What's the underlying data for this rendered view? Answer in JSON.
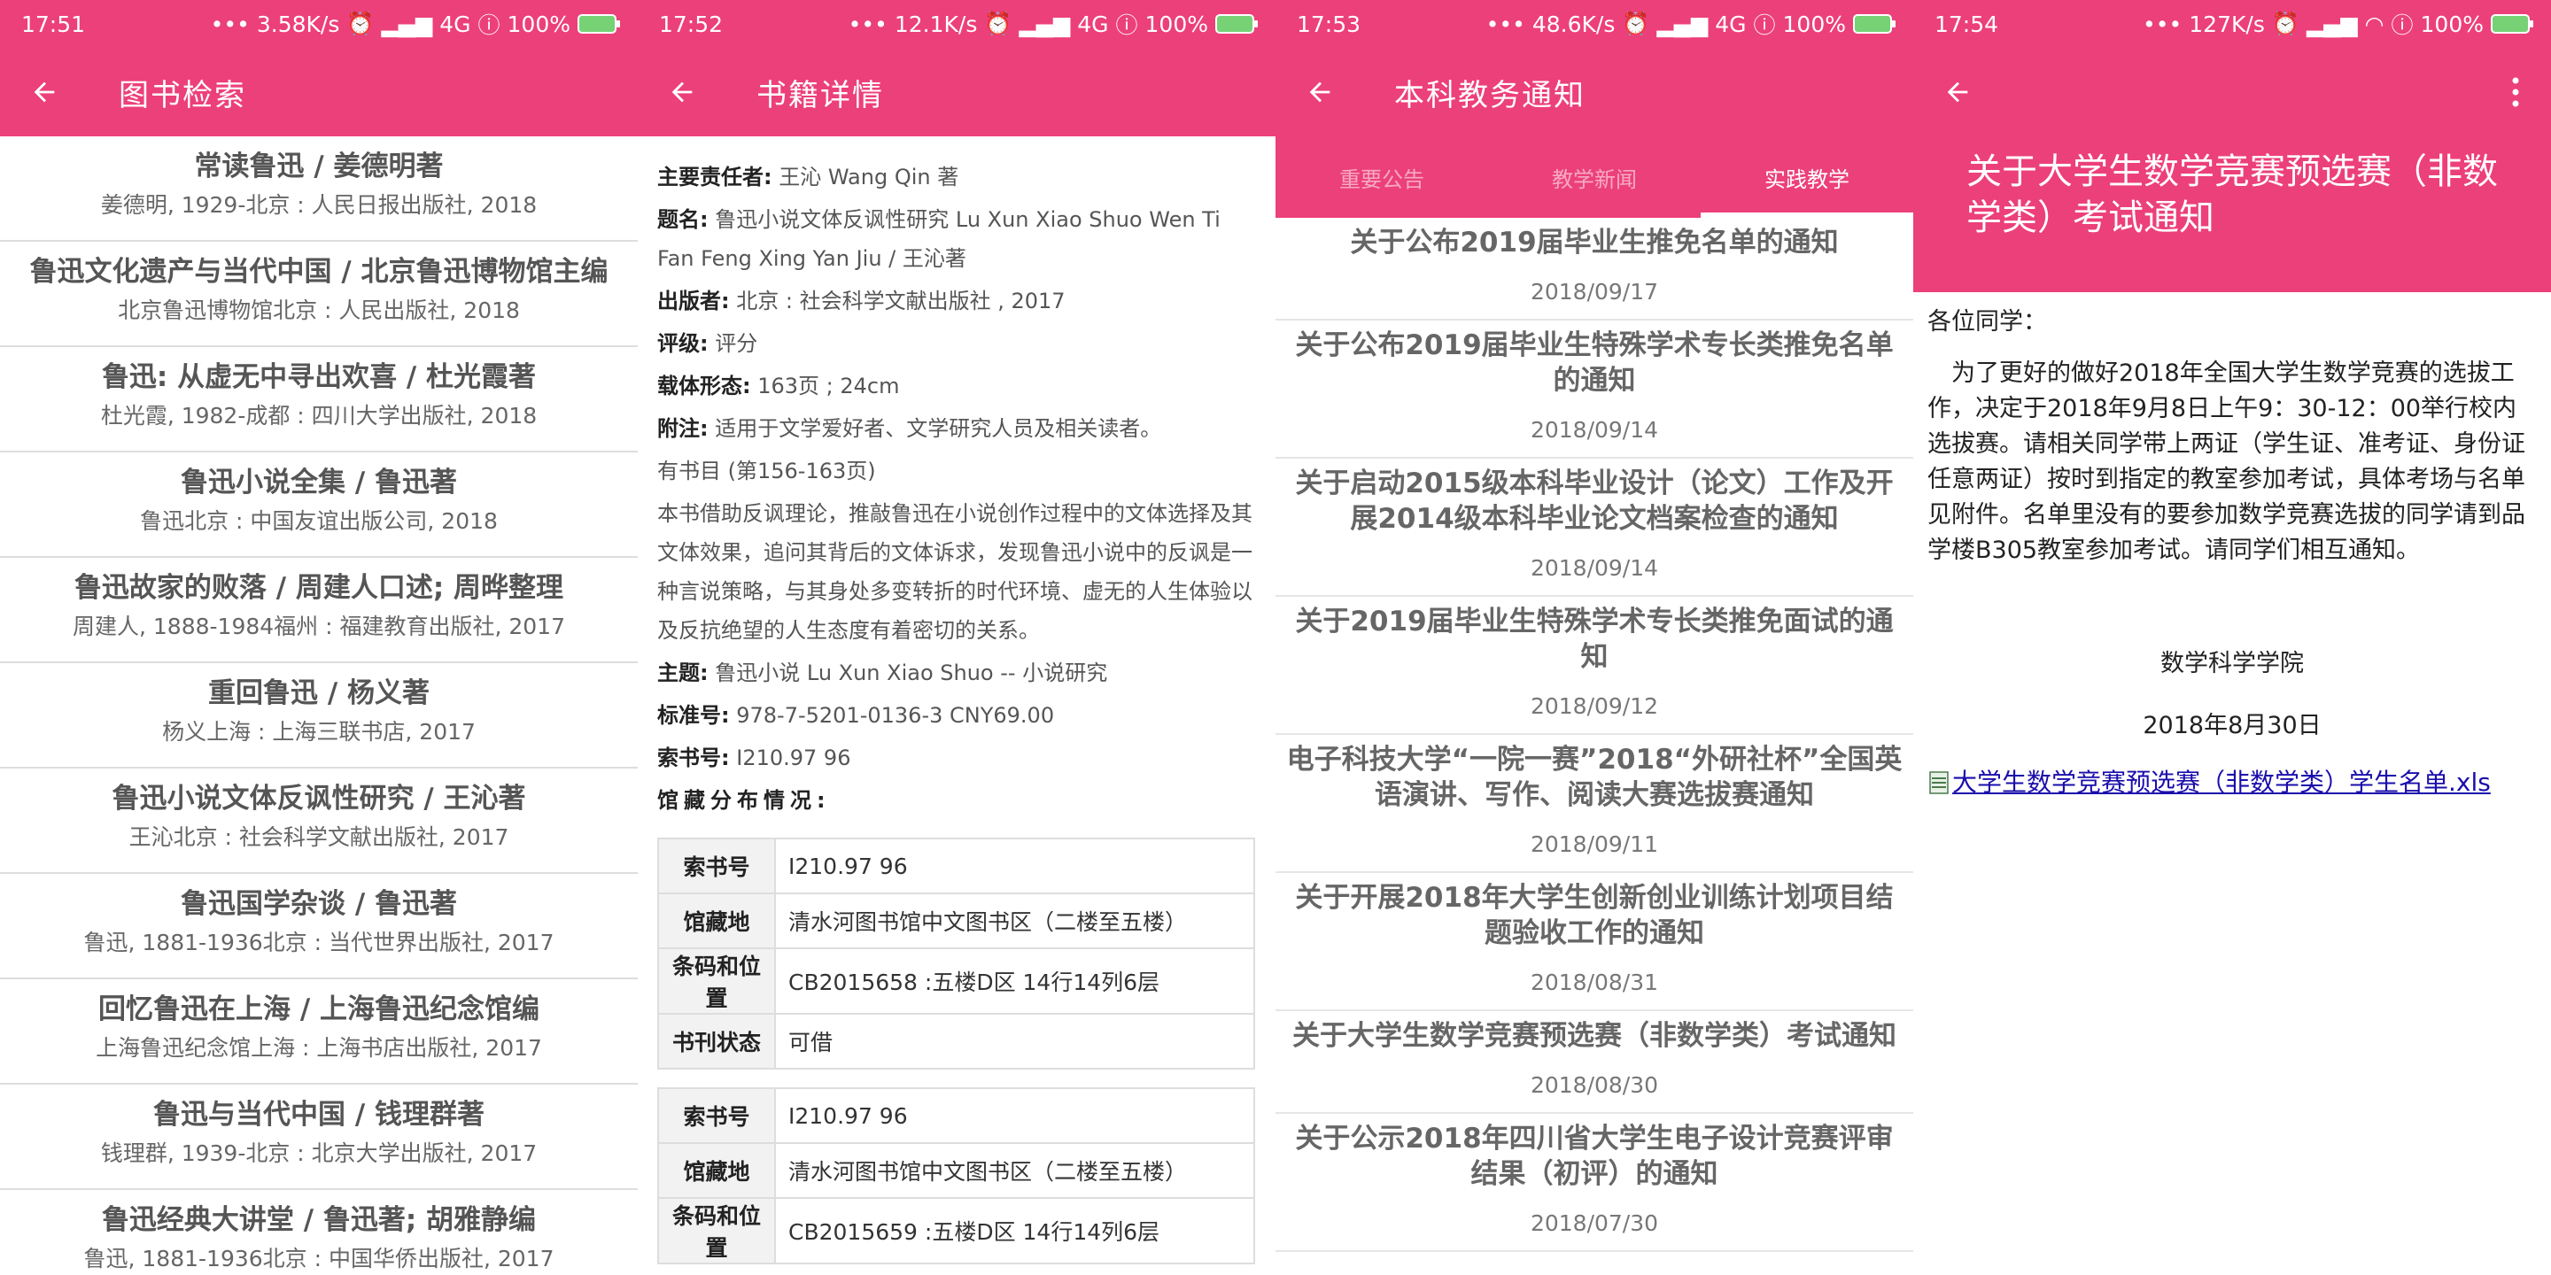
{
  "screens": [
    {
      "status": {
        "time": "17:51",
        "speed": "3.58K/s",
        "net": "4G",
        "battery": "100%"
      },
      "title": "图书检索",
      "books": [
        {
          "title": "常读鲁迅 / 姜德明著",
          "sub": "姜德明, 1929-北京 : 人民日报出版社, 2018"
        },
        {
          "title": "鲁迅文化遗产与当代中国 / 北京鲁迅博物馆主编",
          "sub": "北京鲁迅博物馆北京 : 人民出版社, 2018"
        },
        {
          "title": "鲁迅: 从虚无中寻出欢喜 / 杜光霞著",
          "sub": "杜光霞, 1982-成都 : 四川大学出版社, 2018"
        },
        {
          "title": "鲁迅小说全集 / 鲁迅著",
          "sub": "鲁迅北京 : 中国友谊出版公司, 2018"
        },
        {
          "title": "鲁迅故家的败落 / 周建人口述; 周晔整理",
          "sub": "周建人, 1888-1984福州 : 福建教育出版社, 2017"
        },
        {
          "title": "重回鲁迅 / 杨义著",
          "sub": "杨义上海 : 上海三联书店, 2017"
        },
        {
          "title": "鲁迅小说文体反讽性研究 / 王沁著",
          "sub": "王沁北京 : 社会科学文献出版社, 2017"
        },
        {
          "title": "鲁迅国学杂谈 / 鲁迅著",
          "sub": "鲁迅, 1881-1936北京 : 当代世界出版社, 2017"
        },
        {
          "title": "回忆鲁迅在上海 / 上海鲁迅纪念馆编",
          "sub": "上海鲁迅纪念馆上海 : 上海书店出版社, 2017"
        },
        {
          "title": "鲁迅与当代中国 / 钱理群著",
          "sub": "钱理群, 1939-北京 : 北京大学出版社, 2017"
        },
        {
          "title": "鲁迅经典大讲堂 / 鲁迅著; 胡雅静编",
          "sub": "鲁迅, 1881-1936北京 : 中国华侨出版社, 2017"
        }
      ]
    },
    {
      "status": {
        "time": "17:52",
        "speed": "12.1K/s",
        "net": "4G",
        "battery": "100%"
      },
      "title": "书籍详情",
      "fields": {
        "author_k": "主要责任者:",
        "author_v": " 王沁 Wang Qin 著",
        "title_k": "题名:",
        "title_v": " 鲁迅小说文体反讽性研究 Lu Xun Xiao Shuo Wen Ti Fan Feng Xing Yan Jiu / 王沁著",
        "publisher_k": "出版者:",
        "publisher_v": " 北京 : 社会科学文献出版社 , 2017",
        "rating_k": "评级:",
        "rating_v": " 评分",
        "form_k": "载体形态:",
        "form_v": " 163页 ; 24cm",
        "note_k": "附注:",
        "note_v": " 适用于文学爱好者、文学研究人员及相关读者。",
        "biblio": "有书目 (第156-163页)",
        "abstract": "本书借助反讽理论，推敲鲁迅在小说创作过程中的文体选择及其文体效果，追问其背后的文体诉求，发现鲁迅小说中的反讽是一种言说策略，与其身处多变转折的时代环境、虚无的人生体验以及反抗绝望的人生态度有着密切的关系。",
        "subject_k": "主题:",
        "subject_v": " 鲁迅小说 Lu Xun Xiao Shuo -- 小说研究",
        "isbn_k": "标准号:",
        "isbn_v": " 978-7-5201-0136-3 CNY69.00",
        "call_k": "索书号:",
        "call_v": " I210.97 96",
        "holdings": "馆藏分布情况:"
      },
      "holdings": [
        {
          "k1": "索书号",
          "v1": "I210.97 96",
          "k2": "馆藏地",
          "v2": "清水河图书馆中文图书区（二楼至五楼）",
          "k3": "条码和位置",
          "v3": "CB2015658 :五楼D区 14行14列6层",
          "k4": "书刊状态",
          "v4": "可借"
        },
        {
          "k1": "索书号",
          "v1": "I210.97 96",
          "k2": "馆藏地",
          "v2": "清水河图书馆中文图书区（二楼至五楼）",
          "k3": "条码和位置",
          "v3": "CB2015659 :五楼D区 14行14列6层"
        }
      ]
    },
    {
      "status": {
        "time": "17:53",
        "speed": "48.6K/s",
        "net": "4G",
        "battery": "100%"
      },
      "title": "本科教务通知",
      "tabs": [
        "重要公告",
        "教学新闻",
        "实践教学"
      ],
      "notices": [
        {
          "title": "关于公布2019届毕业生推免名单的通知",
          "date": "2018/09/17"
        },
        {
          "title": "关于公布2019届毕业生特殊学术专长类推免名单的通知",
          "date": "2018/09/14"
        },
        {
          "title": "关于启动2015级本科毕业设计（论文）工作及开展2014级本科毕业论文档案检查的通知",
          "date": "2018/09/14"
        },
        {
          "title": "关于2019届毕业生特殊学术专长类推免面试的通知",
          "date": "2018/09/12"
        },
        {
          "title": "电子科技大学“一院一赛”2018“外研社杯”全国英语演讲、写作、阅读大赛选拔赛通知",
          "date": "2018/09/11"
        },
        {
          "title": "关于开展2018年大学生创新创业训练计划项目结题验收工作的通知",
          "date": "2018/08/31"
        },
        {
          "title": "关于大学生数学竞赛预选赛（非数学类）考试通知",
          "date": "2018/08/30"
        },
        {
          "title": "关于公示2018年四川省大学生电子设计竞赛评审结果（初评）的通知",
          "date": "2018/07/30"
        }
      ]
    },
    {
      "status": {
        "time": "17:54",
        "speed": "127K/s",
        "battery": "100%"
      },
      "title": "关于大学生数学竞赛预选赛（非数学类）考试通知",
      "greeting": "各位同学：",
      "body": "为了更好的做好2018年全国大学生数学竞赛的选拔工作，决定于2018年9月8日上午9：30-12：00举行校内选拔赛。请相关同学带上两证（学生证、准考证、身份证任意两证）按时到指定的教室参加考试，具体考场与名单见附件。名单里没有的要参加数学竞赛选拔的同学请到品学楼B305教室参加考试。请同学们相互通知。",
      "signature": "数学科学学院",
      "date": "2018年8月30日",
      "attachment": "大学生数学竞赛预选赛（非数学类）学生名单.xls"
    }
  ],
  "colors": {
    "primary": "#ec407a"
  }
}
